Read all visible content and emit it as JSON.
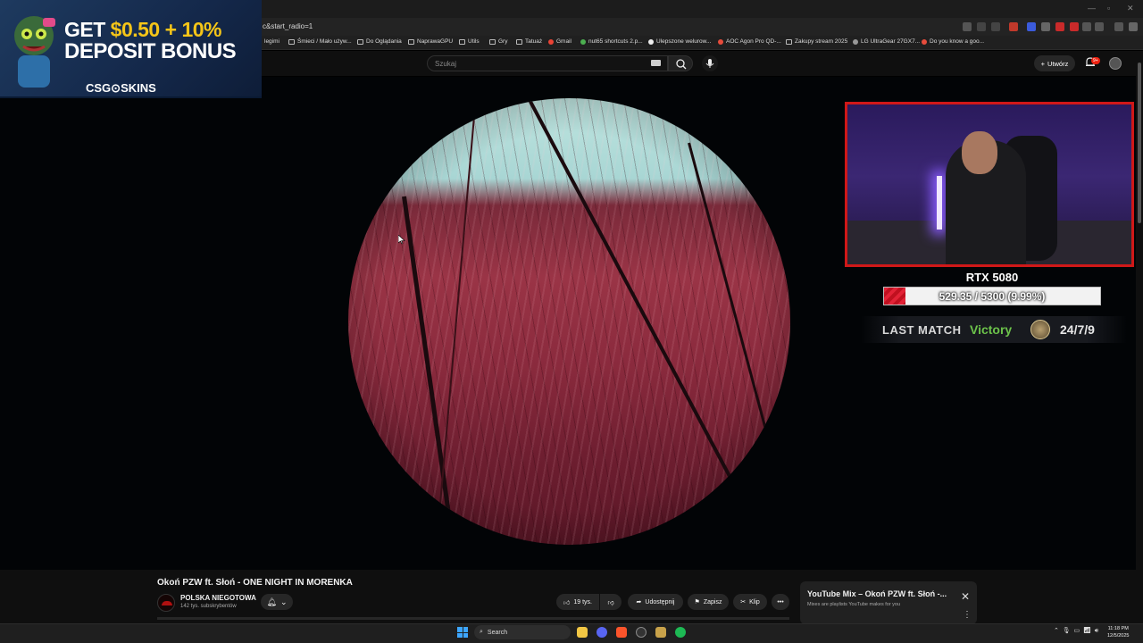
{
  "browser": {
    "url_fragment": "c&start_radio=1",
    "bookmarks": [
      "legimi",
      "Śmieci / Mało używ...",
      "Do Oglądania",
      "NaprawaGPU",
      "Utils",
      "Gry",
      "Tatuaż",
      "Gmail",
      "nut65 shortcuts 2.p...",
      "Ulepszone welurow...",
      "AOC Agon Pro QD-...",
      "Zakupy stream 2025",
      "LG UltraGear 27GX7...",
      "Do you know a goo..."
    ]
  },
  "youtube": {
    "search_placeholder": "Szukaj",
    "create_label": "Utwórz",
    "notif_badge": "9+"
  },
  "ad": {
    "line1_prefix": "GET",
    "line1_amount": "$0.50 + 10%",
    "line2": "DEPOSIT BONUS",
    "brand": "CSG⊙SKINS"
  },
  "overlay": {
    "gpu_label": "RTX 5080",
    "progress_text": "529.35 / 5300 (9.99%)",
    "progress_fraction": 0.0999,
    "last_match_label": "LAST MATCH",
    "last_match_result": "Victory",
    "kda": "24/7/9",
    "accent_red": "#d01818",
    "victory_green": "#6cc24a"
  },
  "video": {
    "title": "Okoń PZW ft. Słoń - ONE NIGHT IN MORENKA",
    "channel_name": "POLSKA NIEGOTOWA",
    "subscribers": "142 tys. subskrybentów",
    "like_count": "19 tys.",
    "share_label": "Udostępnij",
    "save_label": "Zapisz",
    "clip_label": "Klip",
    "more_label": "•••"
  },
  "mix_card": {
    "title": "YouTube Mix – Okoń PZW ft. Słoń -...",
    "subtitle": "Mixes are playlists YouTube makes for you"
  },
  "taskbar": {
    "search_label": "Search",
    "time": "11:18 PM",
    "date": "12/5/2025"
  }
}
